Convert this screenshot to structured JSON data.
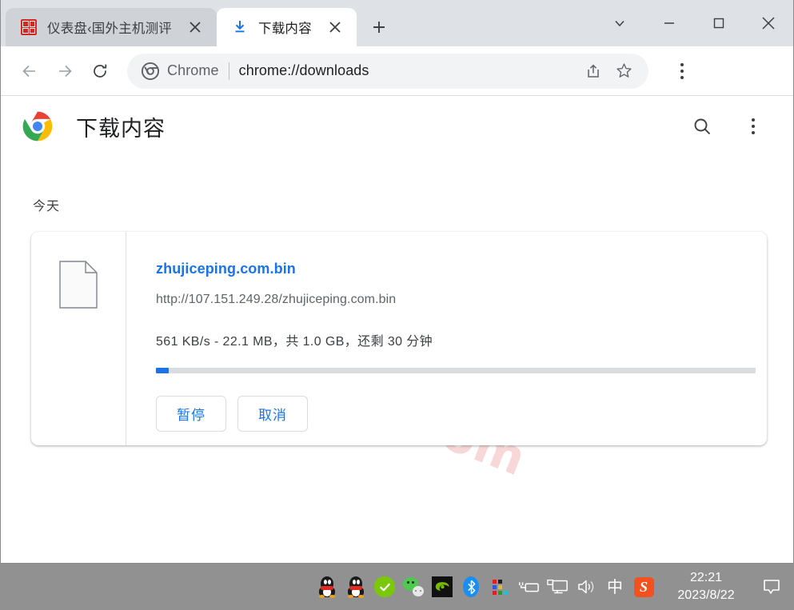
{
  "window": {
    "controls": {
      "tab_search": "tab-search",
      "minimize": "minimize",
      "maximize": "maximize",
      "close": "close"
    }
  },
  "tabs": [
    {
      "title": "仪表盘‹国外主机测评",
      "favicon": "red-seal-favicon",
      "active": false,
      "close_label": "×"
    },
    {
      "title": "下载内容",
      "favicon": "download-icon",
      "active": true,
      "close_label": "×"
    }
  ],
  "newtab": {
    "label": "+"
  },
  "toolbar": {
    "back": "back-arrow",
    "forward": "forward-arrow",
    "reload": "reload",
    "omnibox": {
      "icon": "chrome-logo-grey",
      "scheme_label": "Chrome",
      "url": "chrome://downloads",
      "share": "share-icon",
      "bookmark": "star-icon"
    },
    "menu": "three-dot-menu"
  },
  "page": {
    "logo": "chrome-logo",
    "title": "下载内容",
    "search_button": "search-icon",
    "menu_button": "three-dot-menu",
    "watermark": "zhujiceping.com",
    "section_label": "今天",
    "download": {
      "file_icon": "generic-file-icon",
      "filename": "zhujiceping.com.bin",
      "url": "http://107.151.249.28/zhujiceping.com.bin",
      "status": "561 KB/s - 22.1 MB，共 1.0 GB，还剩 30 分钟",
      "progress_percent": 2.1,
      "progress_color": "#1a73e8",
      "buttons": {
        "pause": "暂停",
        "cancel": "取消"
      }
    }
  },
  "taskbar": {
    "icons": [
      "qq-penguin-icon",
      "qq-penguin-icon",
      "green-check-icon",
      "wechat-icon",
      "nvidia-icon",
      "bluetooth-icon",
      "color-grid-icon",
      "battery-plug-icon",
      "display-icon",
      "volume-icon",
      "ime-chinese-icon",
      "sogou-input-icon"
    ],
    "ime_label": "中",
    "sogou_label": "S",
    "clock": {
      "time": "22:21",
      "date": "2023/8/22"
    },
    "notification": "notification-bubble-icon"
  }
}
